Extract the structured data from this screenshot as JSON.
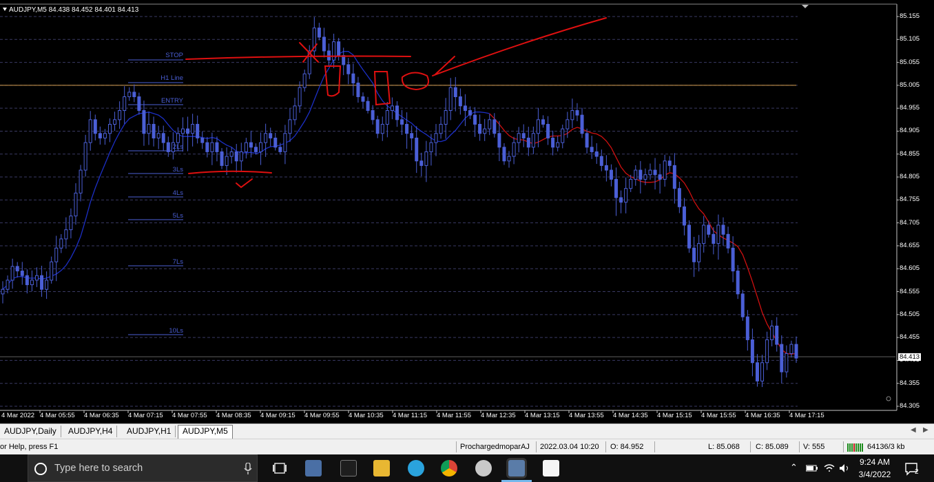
{
  "chart_header": {
    "symbol_info": "AUDJPY,M5  84.438 84.452 84.401 84.413"
  },
  "price_axis": {
    "labels": [
      "85.155",
      "85.105",
      "85.055",
      "85.005",
      "84.955",
      "84.905",
      "84.855",
      "84.805",
      "84.755",
      "84.705",
      "84.655",
      "84.605",
      "84.555",
      "84.505",
      "84.455",
      "84.405",
      "84.355",
      "84.305"
    ],
    "current_price": "84.413"
  },
  "time_axis": {
    "labels": [
      "4 Mar 2022",
      "4 Mar 05:55",
      "4 Mar 06:35",
      "4 Mar 07:15",
      "4 Mar 07:55",
      "4 Mar 08:35",
      "4 Mar 09:15",
      "4 Mar 09:55",
      "4 Mar 10:35",
      "4 Mar 11:15",
      "4 Mar 11:55",
      "4 Mar 12:35",
      "4 Mar 13:15",
      "4 Mar 13:55",
      "4 Mar 14:35",
      "4 Mar 15:15",
      "4 Mar 15:55",
      "4 Mar 16:35",
      "4 Mar 17:15"
    ]
  },
  "levels": {
    "stop": "STOP",
    "h1_line": "H1 Line",
    "entry": "ENTRY",
    "l2": "2Ls",
    "l3": "3Ls",
    "l4": "4Ls",
    "l5": "5Ls",
    "l7": "7Ls",
    "l10": "10Ls"
  },
  "chart_data": {
    "type": "candlestick",
    "symbol": "AUDJPY",
    "timeframe": "M5",
    "ylim": [
      84.3,
      85.16
    ],
    "last_bar": {
      "open": 84.438,
      "high": 84.452,
      "low": 84.401,
      "close": 84.413
    },
    "horizontal_lines": {
      "h1_line": 85.005,
      "current": 84.413
    },
    "closes": [
      84.56,
      84.58,
      84.61,
      84.6,
      84.59,
      84.57,
      84.58,
      84.59,
      84.56,
      84.58,
      84.62,
      84.65,
      84.67,
      84.69,
      84.72,
      84.77,
      84.82,
      84.88,
      84.93,
      84.9,
      84.89,
      84.9,
      84.92,
      84.93,
      84.95,
      84.98,
      84.99,
      84.98,
      84.95,
      84.9,
      84.92,
      84.89,
      84.9,
      84.88,
      84.86,
      84.88,
      84.9,
      84.91,
      84.9,
      84.92,
      84.89,
      84.88,
      84.86,
      84.88,
      84.86,
      84.83,
      84.85,
      84.86,
      84.84,
      84.86,
      84.88,
      84.87,
      84.86,
      84.88,
      84.9,
      84.89,
      84.87,
      84.86,
      84.9,
      84.93,
      84.96,
      85.0,
      85.03,
      85.08,
      85.13,
      85.11,
      85.08,
      85.06,
      85.1,
      85.07,
      85.05,
      85.03,
      85.01,
      84.98,
      84.97,
      84.95,
      84.93,
      84.9,
      84.92,
      84.95,
      84.96,
      84.93,
      84.92,
      84.9,
      84.89,
      84.84,
      84.83,
      84.86,
      84.88,
      84.9,
      84.92,
      84.95,
      85.0,
      84.98,
      84.96,
      84.95,
      84.94,
      84.92,
      84.9,
      84.91,
      84.93,
      84.9,
      84.87,
      84.84,
      84.85,
      84.88,
      84.9,
      84.89,
      84.87,
      84.9,
      84.93,
      84.92,
      84.89,
      84.87,
      84.88,
      84.91,
      84.93,
      84.95,
      84.94,
      84.9,
      84.87,
      84.86,
      84.85,
      84.83,
      84.82,
      84.8,
      84.76,
      84.75,
      84.78,
      84.8,
      84.82,
      84.8,
      84.81,
      84.82,
      84.81,
      84.8,
      84.84,
      84.83,
      84.78,
      84.74,
      84.7,
      84.65,
      84.62,
      84.66,
      84.7,
      84.68,
      84.66,
      84.7,
      84.68,
      84.65,
      84.6,
      84.55,
      84.5,
      84.45,
      84.4,
      84.36,
      84.4,
      84.45,
      84.48,
      84.44,
      84.38,
      84.42,
      84.44,
      84.41
    ],
    "ma_blue_start": 84.54,
    "ma_red_end": 84.54,
    "series": [
      {
        "name": "",
        "role": "blue moving average",
        "color": "#1c2fc6"
      },
      {
        "name": "",
        "role": "red moving average",
        "color": "#d01010"
      }
    ]
  },
  "tabs": [
    "AUDJPY,Daily",
    "AUDJPY,H4",
    "AUDJPY,H1",
    "AUDJPY,M5"
  ],
  "active_tab": "AUDJPY,M5",
  "status_bar": {
    "help": "or Help, press F1",
    "profile": "ProchargedmoparAJ",
    "datetime": "2022.03.04 10:20",
    "open": "O: 84.952",
    "low": "L: 85.068",
    "close": "C: 85.089",
    "volume": "V: 555",
    "traffic": "64136/3 kb"
  },
  "taskbar": {
    "search_placeholder": "Type here to search",
    "time": "9:24 AM",
    "date": "3/4/2022",
    "notification_count": "2"
  },
  "colors": {
    "grid": "#3a3a64",
    "candle": "#4b5fd6",
    "level": "#4b5fd6",
    "h1_line": "#d8a050",
    "annotation": "#e01010"
  }
}
